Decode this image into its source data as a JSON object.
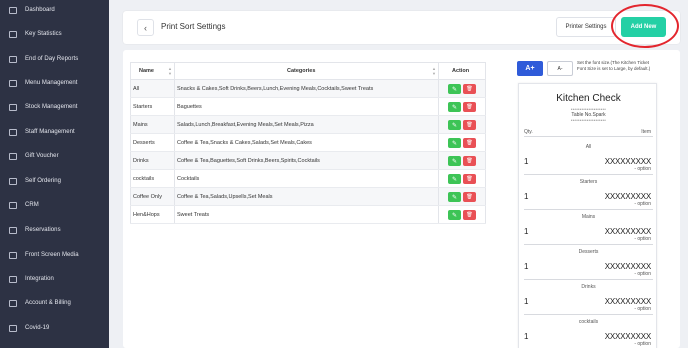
{
  "sidebar": {
    "items": [
      {
        "label": "Dashboard",
        "icon": "dashboard-icon"
      },
      {
        "label": "Key Statistics",
        "icon": "chart-icon"
      },
      {
        "label": "End of Day Reports",
        "icon": "report-icon"
      },
      {
        "label": "Menu Management",
        "icon": "menu-icon"
      },
      {
        "label": "Stock Management",
        "icon": "stock-icon"
      },
      {
        "label": "Staff Management",
        "icon": "staff-icon"
      },
      {
        "label": "Gift Voucher",
        "icon": "gift-icon"
      },
      {
        "label": "Self Ordering",
        "icon": "self-order-icon"
      },
      {
        "label": "CRM",
        "icon": "crm-icon"
      },
      {
        "label": "Reservations",
        "icon": "calendar-icon"
      },
      {
        "label": "Front Screen Media",
        "icon": "screen-icon"
      },
      {
        "label": "Integration",
        "icon": "integration-icon"
      },
      {
        "label": "Account & Billing",
        "icon": "billing-icon"
      },
      {
        "label": "Covid-19",
        "icon": "shield-icon"
      }
    ]
  },
  "header": {
    "back_icon": "‹",
    "title": "Print Sort Settings",
    "printer_settings_label": "Printer Settings",
    "add_new_label": "Add New"
  },
  "table": {
    "columns": {
      "name": "Name",
      "categories": "Categories",
      "action": "Action"
    },
    "edit_icon": "✎",
    "delete_icon": "🗑",
    "rows": [
      {
        "name": "All",
        "categories": "Snacks & Cakes,Soft Drinks,Beers,Lunch,Evening Meals,Cocktails,Sweet Treats"
      },
      {
        "name": "Starters",
        "categories": "Baguettes"
      },
      {
        "name": "Mains",
        "categories": "Salads,Lunch,Breakfast,Evening Meals,Set Meals,Pizza"
      },
      {
        "name": "Desserts",
        "categories": "Coffee & Tea,Snacks & Cakes,Salads,Set Meals,Cakes"
      },
      {
        "name": "Drinks",
        "categories": "Coffee & Tea,Baguettes,Soft Drinks,Beers,Spirits,Cocktails"
      },
      {
        "name": "cocktails",
        "categories": "Cocktails"
      },
      {
        "name": "Coffee Only",
        "categories": "Coffee & Tea,Salads,Upsells,Set Meals"
      },
      {
        "name": "Hen&Hops",
        "categories": "Sweet Treats"
      }
    ]
  },
  "font_controls": {
    "increase_label": "A+",
    "decrease_label": "A-",
    "hint": "Set the font size.(The Kitchen Ticket Font Size is set to Large, by default.)"
  },
  "ticket": {
    "title": "Kitchen Check",
    "stars": "********************",
    "table_label": "Table No.Spark",
    "qty_header": "Qty.",
    "item_header": "Item",
    "sections": [
      {
        "category": "All",
        "qty": "1",
        "item": "XXXXXXXXX",
        "option": "- option"
      },
      {
        "category": "Starters",
        "qty": "1",
        "item": "XXXXXXXXX",
        "option": "- option"
      },
      {
        "category": "Mains",
        "qty": "1",
        "item": "XXXXXXXXX",
        "option": "- option"
      },
      {
        "category": "Desserts",
        "qty": "1",
        "item": "XXXXXXXXX",
        "option": "- option"
      },
      {
        "category": "Drinks",
        "qty": "1",
        "item": "XXXXXXXXX",
        "option": "- option"
      },
      {
        "category": "cocktails",
        "qty": "1",
        "item": "XXXXXXXXX",
        "option": "- option"
      }
    ]
  },
  "colors": {
    "sidebar_bg": "#2d3244",
    "add_new": "#24d0a5",
    "edit": "#3dc456",
    "delete": "#e95055",
    "font_button": "#2f5bd9",
    "highlight": "#e3262e"
  }
}
